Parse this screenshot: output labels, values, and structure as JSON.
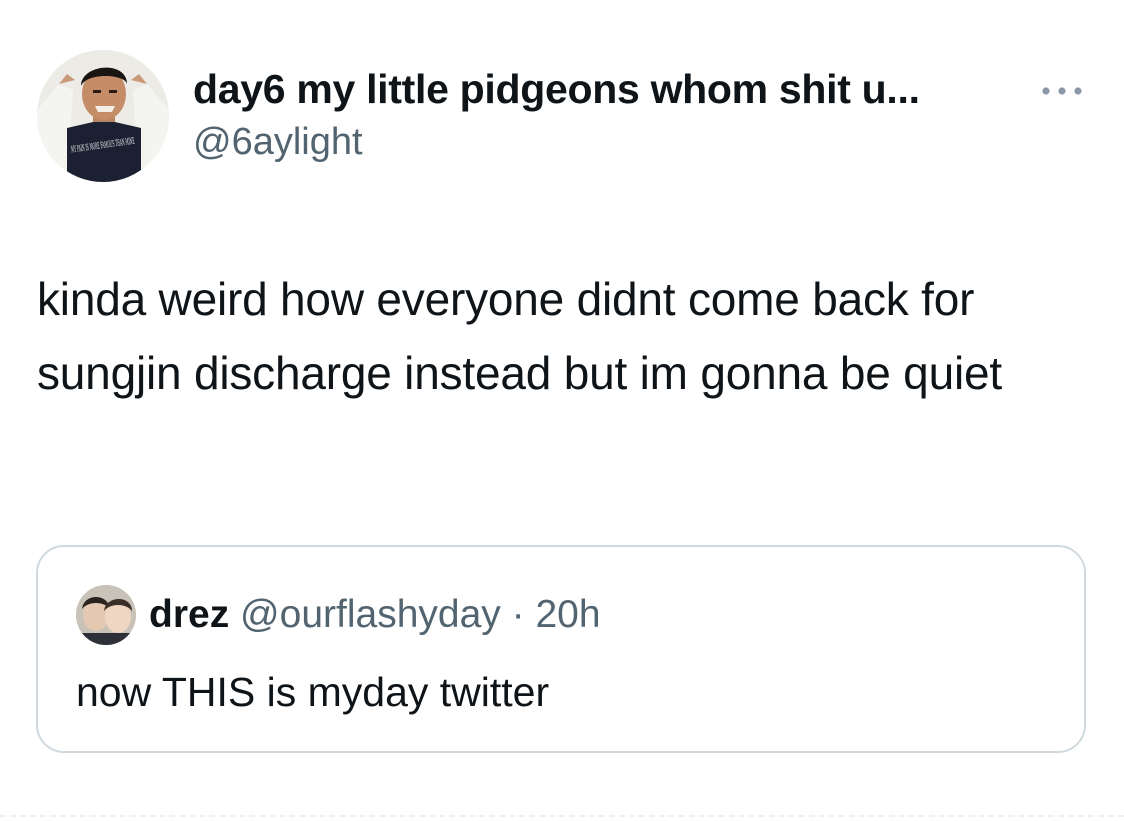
{
  "tweet": {
    "author": {
      "display_name": "day6 my little pidgeons whom shit u...",
      "handle": "@6aylight",
      "avatar_shirt_text": "MY PAIN IS MORE FAMOUS THAN MINE"
    },
    "more_icon": "ellipsis-icon",
    "text": "kinda weird how everyone didnt come back for sungjin discharge instead but im gonna be quiet",
    "quoted": {
      "display_name": "drez",
      "handle": "@ourflashyday",
      "separator": "·",
      "time": "20h",
      "text": "now THIS is myday twitter"
    }
  },
  "colors": {
    "text_primary": "#0f1419",
    "text_secondary": "#536471",
    "border": "#cfd9de",
    "background": "#ffffff"
  }
}
